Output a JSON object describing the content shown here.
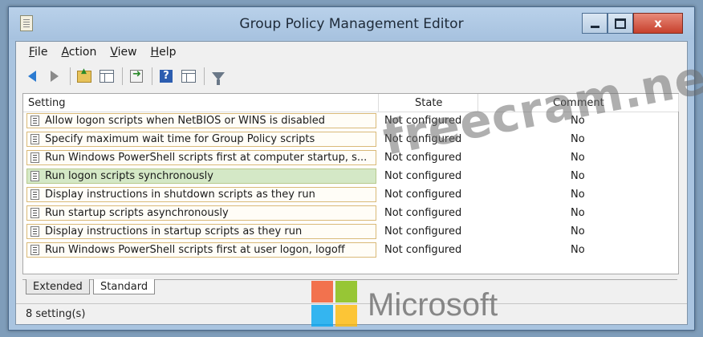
{
  "window": {
    "title": "Group Policy Management Editor",
    "close_glyph": "x"
  },
  "menu": {
    "file": {
      "accel": "F",
      "rest": "ile"
    },
    "action": {
      "accel": "A",
      "rest": "ction"
    },
    "view": {
      "accel": "V",
      "rest": "iew"
    },
    "help": {
      "accel": "H",
      "rest": "elp"
    }
  },
  "toolbar": {
    "icons": [
      "back-arrow-icon",
      "forward-arrow-icon",
      "up-folder-icon",
      "show-hide-tree-icon",
      "export-list-icon",
      "help-icon",
      "show-hide-action-pane-icon",
      "filter-icon"
    ]
  },
  "list": {
    "headers": {
      "setting": "Setting",
      "state": "State",
      "comment": "Comment"
    },
    "rows": [
      {
        "setting": "Allow logon scripts when NetBIOS or WINS is disabled",
        "state": "Not configured",
        "comment": "No"
      },
      {
        "setting": "Specify maximum wait time for Group Policy scripts",
        "state": "Not configured",
        "comment": "No"
      },
      {
        "setting": "Run Windows PowerShell scripts first at computer startup, s...",
        "state": "Not configured",
        "comment": "No"
      },
      {
        "setting": "Run logon scripts synchronously",
        "state": "Not configured",
        "comment": "No"
      },
      {
        "setting": "Display instructions in shutdown scripts as they run",
        "state": "Not configured",
        "comment": "No"
      },
      {
        "setting": "Run startup scripts asynchronously",
        "state": "Not configured",
        "comment": "No"
      },
      {
        "setting": "Display instructions in startup scripts as they run",
        "state": "Not configured",
        "comment": "No"
      },
      {
        "setting": "Run Windows PowerShell scripts first at user logon, logoff",
        "state": "Not configured",
        "comment": "No"
      }
    ],
    "selected_row": 3
  },
  "tabs": {
    "extended": "Extended",
    "standard": "Standard",
    "active": "standard"
  },
  "status": {
    "text": "8 setting(s)"
  },
  "watermark": {
    "text": "freecram.net"
  },
  "logo": {
    "text": "Microsoft"
  },
  "colors": {
    "selection": "#d4e8c6",
    "row_border": "#d9b978",
    "close_button": "#c7402c"
  }
}
